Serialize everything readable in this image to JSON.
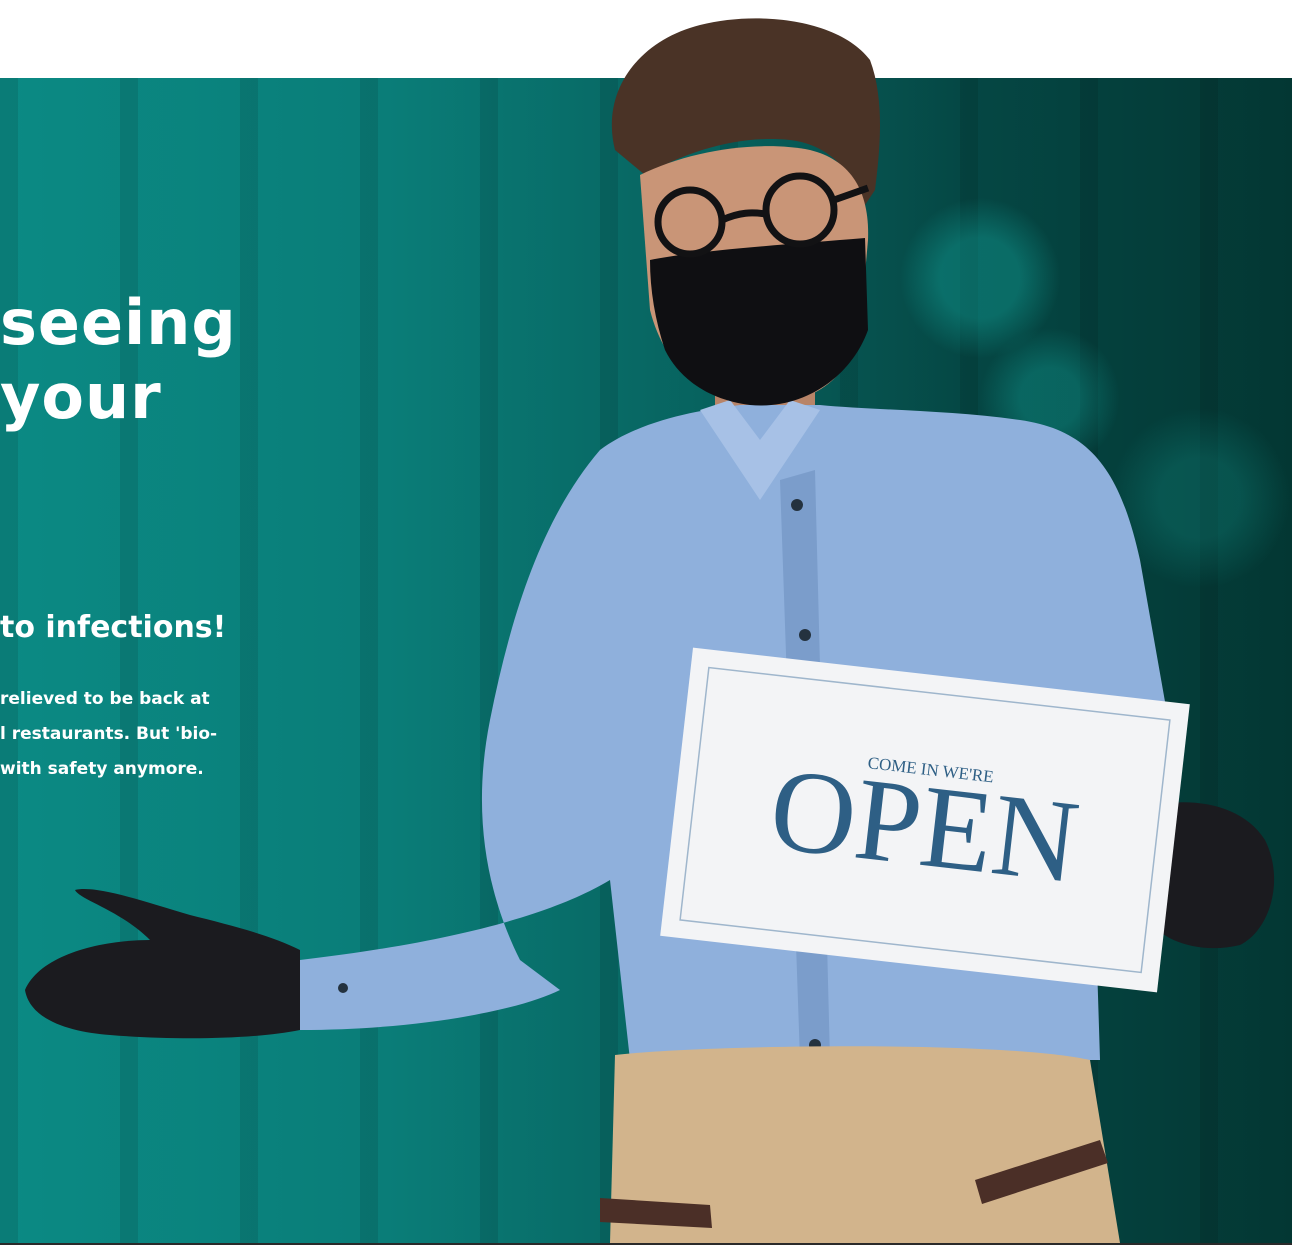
{
  "hero": {
    "headline_lines": [
      " seeing",
      " your"
    ],
    "subheading": "to infections!",
    "paragraph_lines": [
      "relieved to be back at",
      "l restaurants. But 'bio-",
      " with safety anymore."
    ],
    "sign": {
      "small": "COME IN WE'RE",
      "large": "OPEN"
    },
    "colors": {
      "teal": "#0a7d78",
      "dark_teal": "#033733",
      "shirt": "#8fb0dc",
      "apron": "#d2b48c"
    }
  }
}
